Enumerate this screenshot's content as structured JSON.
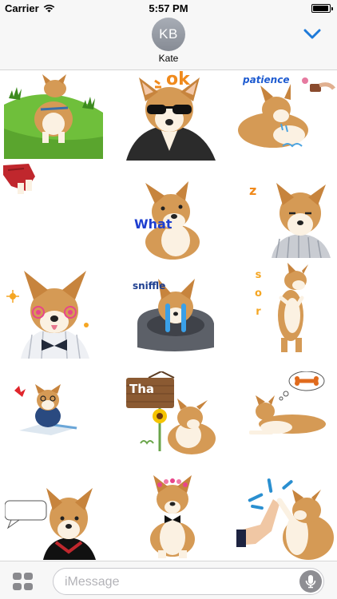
{
  "status_bar": {
    "carrier": "Carrier",
    "time": "5:57 PM"
  },
  "header": {
    "avatar_initials": "KB",
    "contact_name": "Kate"
  },
  "stickers": [
    {
      "caption": ""
    },
    {
      "caption": "ok"
    },
    {
      "caption": "patience"
    },
    {
      "caption": ""
    },
    {
      "caption": "What"
    },
    {
      "caption": "z"
    },
    {
      "caption": ""
    },
    {
      "caption": "sniffle"
    },
    {
      "caption": "sor"
    },
    {
      "caption": ""
    },
    {
      "caption": "Tha"
    },
    {
      "caption": ""
    },
    {
      "caption": ""
    },
    {
      "caption": ""
    },
    {
      "caption": ""
    }
  ],
  "input": {
    "placeholder": "iMessage"
  },
  "colors": {
    "accent": "#1e7ad9",
    "fur": "#d59a55",
    "cream": "#fbf1e2",
    "grass": "#6fbf3b"
  }
}
